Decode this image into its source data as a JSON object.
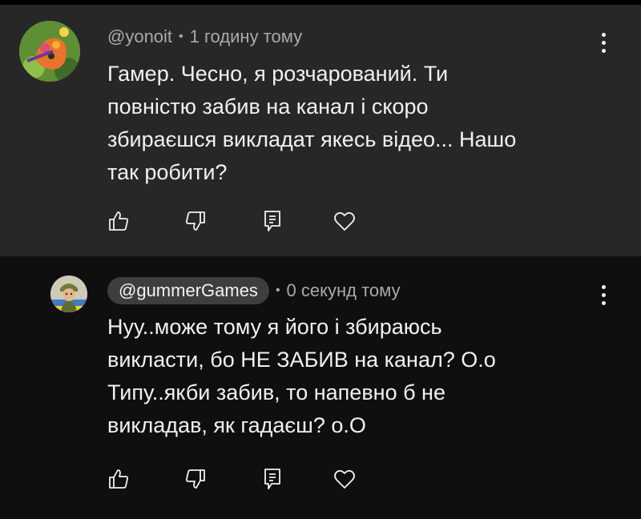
{
  "comments": [
    {
      "author": "@yonoit",
      "time": "1 годину тому",
      "text": "Гамер. Чесно, я розчарований. Ти\nповністю забив на канал і скоро\nзбираєшся викладат якесь відео... Нашо\nтак робити?",
      "icons": [
        "like-icon",
        "dislike-icon",
        "reply-icon",
        "heart-icon",
        "more-vertical-icon"
      ]
    },
    {
      "author": "@gummerGames",
      "time": "0 секунд тому",
      "text": "Нуу..може тому я його і збираюсь\nвикласти, бо НЕ ЗАБИВ на канал? О.о\nТипу..якби забив, то напевно б не\nвикладав, як гадаєш? о.О",
      "icons": [
        "like-icon",
        "dislike-icon",
        "reply-icon",
        "heart-icon",
        "more-vertical-icon"
      ]
    }
  ],
  "colors": {
    "background": "#0f0f0f",
    "highlighted_comment_bg": "#272727",
    "text": "#f1f1f1",
    "meta_text": "#aaaaaa",
    "author_chip": "#3e3e3e"
  },
  "separator": "•"
}
